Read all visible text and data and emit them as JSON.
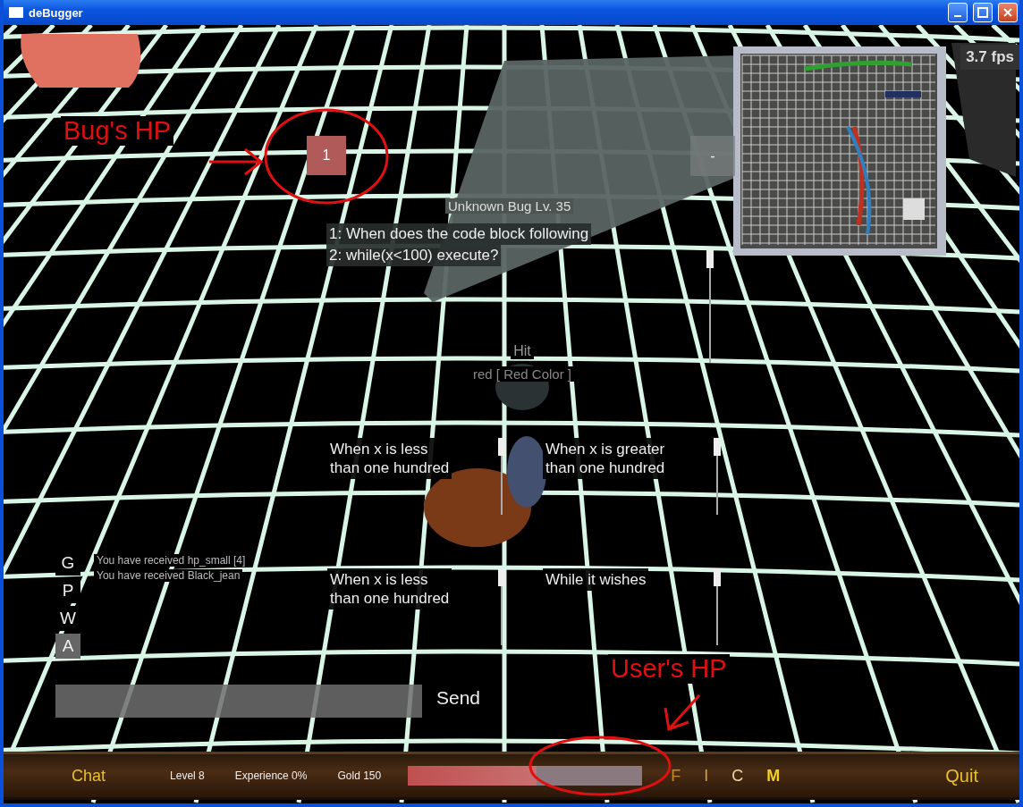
{
  "window": {
    "title": "deBugger"
  },
  "hud": {
    "fps": "3.7 fps",
    "bug_hp": "1",
    "collapse_button": "-"
  },
  "question": {
    "title": "Unknown Bug Lv. 35",
    "lines": [
      "1: When does the code block following",
      "2: while(x<100) execute?"
    ]
  },
  "hit": {
    "label": "Hit",
    "detail": "red [ Red Color ]"
  },
  "answers": [
    {
      "lines": [
        "When x is less",
        "than one hundred"
      ]
    },
    {
      "lines": [
        "When x is greater",
        "than one hundred"
      ]
    },
    {
      "lines": [
        "When x is less",
        "than one hundred"
      ]
    },
    {
      "lines": [
        "While it wishes"
      ]
    }
  ],
  "chat": {
    "tabs": [
      {
        "label": "G",
        "selected": false
      },
      {
        "label": "P",
        "selected": false
      },
      {
        "label": "W",
        "selected": false
      },
      {
        "label": "A",
        "selected": true
      }
    ],
    "messages": [
      "You have received hp_small [4]",
      "You have received Black_jean"
    ],
    "send": "Send"
  },
  "bottom_bar": {
    "chat": "Chat",
    "level": "Level 8",
    "experience": "Experience 0%",
    "gold": "Gold 150",
    "hp": {
      "level": 0.55
    },
    "menu": [
      {
        "label": "F",
        "color": "#c98a2a"
      },
      {
        "label": "I",
        "color": "#d9a030"
      },
      {
        "label": "C",
        "color": "#e8d9a0"
      },
      {
        "label": "M",
        "color": "#f5d020"
      }
    ],
    "quit": "Quit"
  },
  "annotations": [
    {
      "text": "Bug's HP"
    },
    {
      "text": "User's HP"
    }
  ]
}
